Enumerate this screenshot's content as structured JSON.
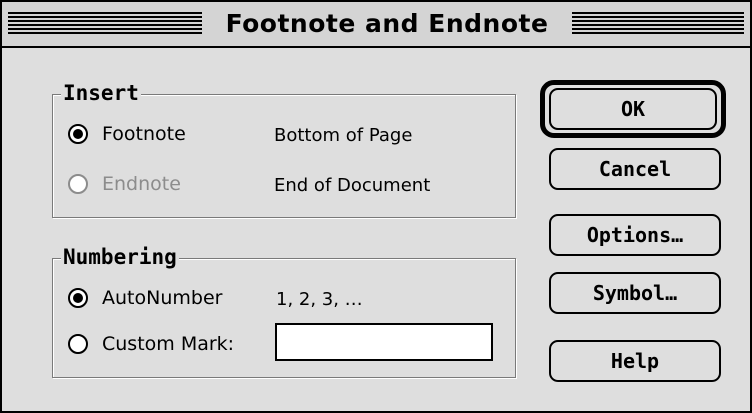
{
  "window": {
    "title": "Footnote and Endnote"
  },
  "insert": {
    "legend": "Insert",
    "options": [
      {
        "label": "Footnote",
        "description": "Bottom of Page",
        "selected": true,
        "enabled": true
      },
      {
        "label": "Endnote",
        "description": "End of Document",
        "selected": false,
        "enabled": false
      }
    ]
  },
  "numbering": {
    "legend": "Numbering",
    "options": [
      {
        "label": "AutoNumber",
        "description": "1, 2, 3, …",
        "selected": true
      },
      {
        "label": "Custom Mark:",
        "selected": false
      }
    ],
    "custom_mark_value": ""
  },
  "buttons": {
    "ok": "OK",
    "cancel": "Cancel",
    "options": "Options…",
    "symbol": "Symbol…",
    "help": "Help"
  }
}
